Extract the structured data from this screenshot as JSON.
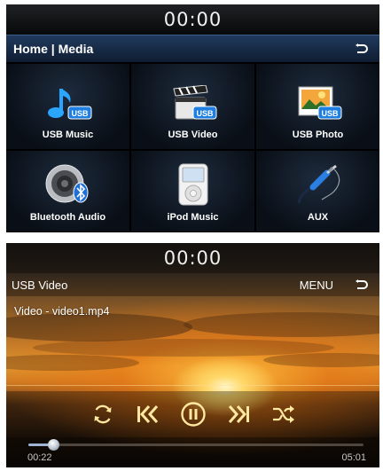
{
  "home_screen": {
    "clock": "00:00",
    "header_title": "Home | Media",
    "tiles": [
      {
        "label": "USB Music",
        "icon": "usb-music-icon"
      },
      {
        "label": "USB Video",
        "icon": "usb-video-icon"
      },
      {
        "label": "USB Photo",
        "icon": "usb-photo-icon"
      },
      {
        "label": "Bluetooth Audio",
        "icon": "bluetooth-audio-icon"
      },
      {
        "label": "iPod Music",
        "icon": "ipod-icon"
      },
      {
        "label": "AUX",
        "icon": "aux-cable-icon"
      }
    ],
    "badge_text": "USB"
  },
  "video_screen": {
    "clock": "00:00",
    "header_title": "USB Video",
    "menu_label": "MENU",
    "filename": "Video - video1.mp4",
    "controls": [
      "repeat-icon",
      "previous-icon",
      "pause-icon",
      "next-icon",
      "shuffle-icon"
    ],
    "elapsed": "00:22",
    "total": "05:01",
    "progress": 0.073
  },
  "colors": {
    "header_blue": "#1a3050",
    "usb_badge": "#1f7fe0",
    "control_yellow": "#ffe9a0"
  }
}
